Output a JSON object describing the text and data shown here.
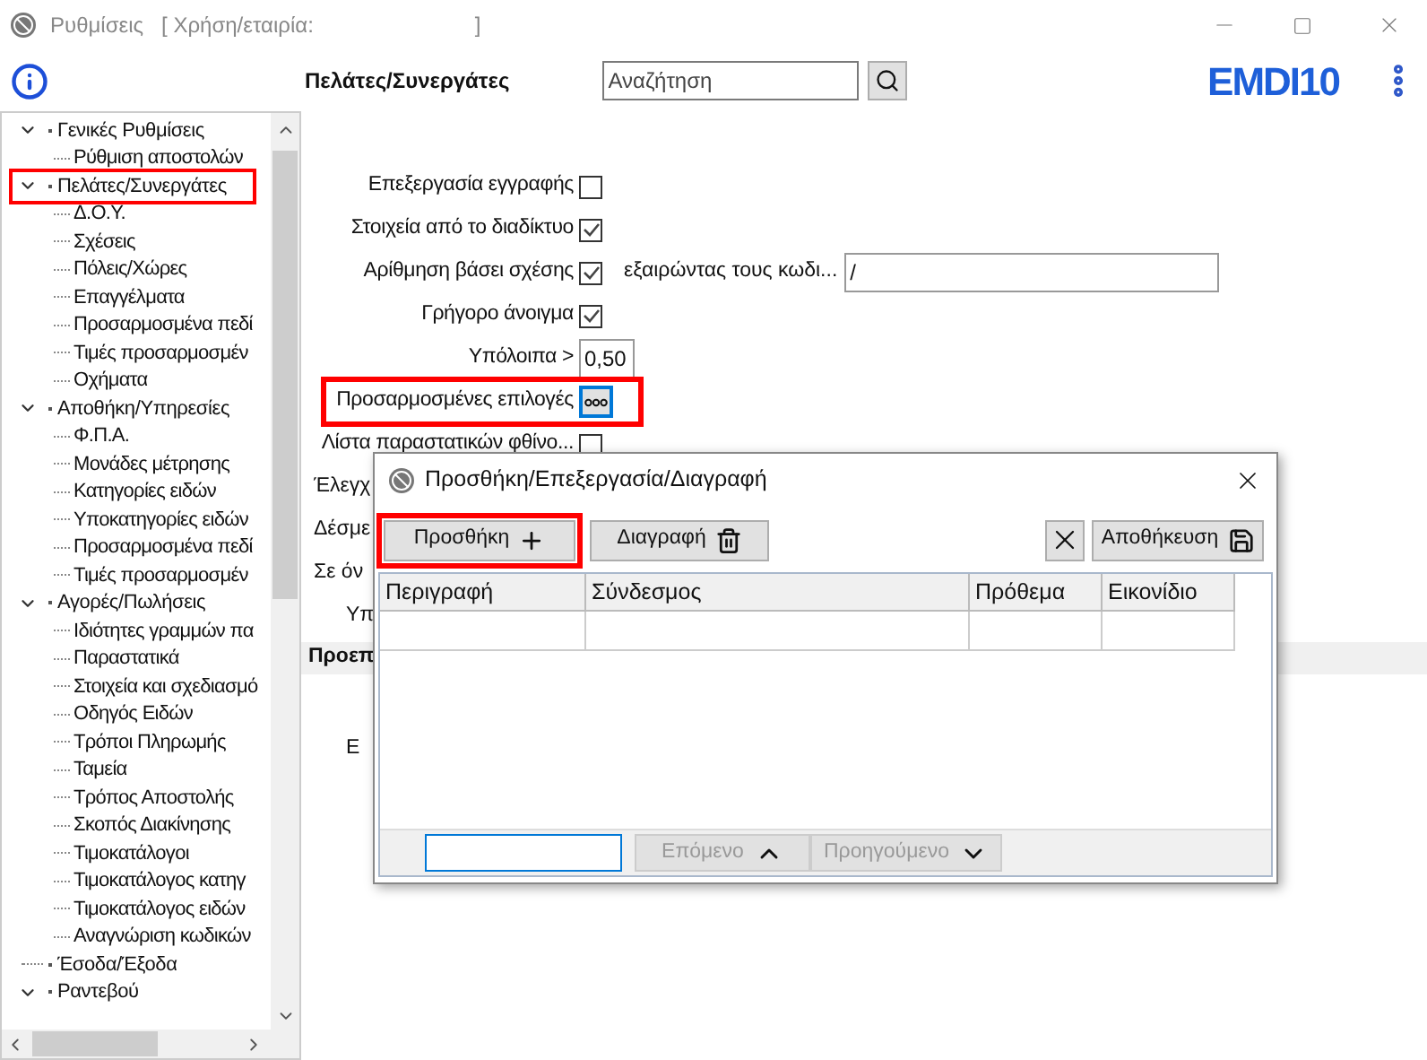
{
  "window": {
    "title": "Ρυθμίσεις",
    "context": "[ Χρήση/εταιρία:",
    "context_end": "]"
  },
  "header": {
    "title": "Πελάτες/Συνεργάτες",
    "search": {
      "placeholder": "Αναζήτηση"
    },
    "logo": "EMDI10"
  },
  "tree": [
    {
      "label": "Γενικές Ρυθμίσεις",
      "expanded": true,
      "highlighted": false,
      "children": [
        {
          "label": "Ρύθμιση αποστολών"
        }
      ]
    },
    {
      "label": "Πελάτες/Συνεργάτες",
      "expanded": true,
      "highlighted": true,
      "children": [
        {
          "label": "Δ.Ο.Υ."
        },
        {
          "label": "Σχέσεις"
        },
        {
          "label": "Πόλεις/Χώρες"
        },
        {
          "label": "Επαγγέλματα"
        },
        {
          "label": "Προσαρμοσμένα πεδί"
        },
        {
          "label": "Τιμές προσαρμοσμέν"
        },
        {
          "label": "Οχήματα"
        }
      ]
    },
    {
      "label": "Αποθήκη/Υπηρεσίες",
      "expanded": true,
      "highlighted": false,
      "children": [
        {
          "label": "Φ.Π.Α."
        },
        {
          "label": "Μονάδες μέτρησης"
        },
        {
          "label": "Κατηγορίες ειδών"
        },
        {
          "label": "Υποκατηγορίες ειδών"
        },
        {
          "label": "Προσαρμοσμένα πεδί"
        },
        {
          "label": "Τιμές προσαρμοσμέν"
        }
      ]
    },
    {
      "label": "Αγορές/Πωλήσεις",
      "expanded": true,
      "highlighted": false,
      "children": [
        {
          "label": "Ιδιότητες γραμμών πα"
        },
        {
          "label": "Παραστατικά"
        },
        {
          "label": "Στοιχεία και σχεδιασμό"
        },
        {
          "label": "Οδηγός Ειδών"
        },
        {
          "label": "Τρόποι Πληρωμής"
        },
        {
          "label": "Ταμεία"
        },
        {
          "label": "Τρόπος Αποστολής"
        },
        {
          "label": "Σκοπός Διακίνησης"
        },
        {
          "label": "Τιμοκατάλογοι"
        },
        {
          "label": "Τιμοκατάλογος κατηγ"
        },
        {
          "label": "Τιμοκατάλογος ειδών"
        },
        {
          "label": "Αναγνώριση κωδικών"
        }
      ]
    },
    {
      "label": "Έσοδα/Έξοδα",
      "expanded": false,
      "highlighted": false
    },
    {
      "label": "Ραντεβού",
      "expanded": true,
      "highlighted": false
    }
  ],
  "form": [
    {
      "kind": "checkbox",
      "label": "Επεξεργασία εγγραφής",
      "checked": false,
      "highlighted": false
    },
    {
      "kind": "checkbox",
      "label": "Στοιχεία από το διαδίκτυο",
      "checked": true,
      "highlighted": false
    },
    {
      "kind": "checkbox",
      "label": "Αρίθμηση βάσει σχέσης",
      "checked": true,
      "highlighted": false,
      "extra_label": "εξαιρώντας τους κωδι...",
      "extra_value": "/"
    },
    {
      "kind": "checkbox",
      "label": "Γρήγορο άνοιγμα",
      "checked": true,
      "highlighted": false
    },
    {
      "kind": "number",
      "label": "Υπόλοιπα >",
      "value": "0,50",
      "highlighted": false
    },
    {
      "kind": "button",
      "label": "Προσαρμοσμένες επιλογές",
      "highlighted": true
    },
    {
      "kind": "checkbox",
      "label": "Λίστα παραστατικών φθίνο...",
      "checked": false,
      "highlighted": false
    }
  ],
  "covered_rows": [
    {
      "kind": "label",
      "text": "Έλεγχ"
    },
    {
      "kind": "label",
      "text": "Δέσμε"
    },
    {
      "kind": "label",
      "text": "Σε όν"
    },
    {
      "kind": "label",
      "text": "Υπ"
    },
    {
      "kind": "section",
      "text": "Προεπ"
    },
    {
      "kind": "label",
      "text": "Ε"
    }
  ],
  "dialog": {
    "title": "Προσθήκη/Επεξεργασία/Διαγραφή",
    "toolbar": [
      {
        "kind": "add",
        "label": "Προσθήκη",
        "highlighted": true
      },
      {
        "kind": "delete",
        "label": "Διαγραφή",
        "highlighted": false
      },
      {
        "kind": "cancel",
        "highlighted": false
      },
      {
        "kind": "save",
        "label": "Αποθήκευση",
        "highlighted": false
      }
    ],
    "table": {
      "columns": [
        "Περιγραφή",
        "Σύνδεσμος",
        "Πρόθεμα",
        "Εικονίδιο"
      ]
    },
    "footer": {
      "buttons": [
        {
          "kind": "up",
          "label": "Επόμενο",
          "disabled": true
        },
        {
          "kind": "down",
          "label": "Προηγούμενο",
          "disabled": true
        }
      ]
    }
  }
}
